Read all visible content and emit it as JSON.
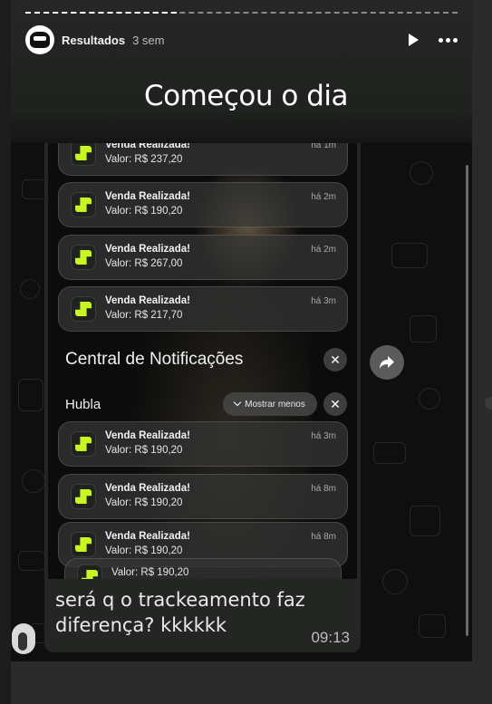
{
  "story": {
    "username": "Resultados",
    "time_ago": "3 sem",
    "progress": 0.35,
    "caption": "Começou o dia"
  },
  "icons": {
    "play": "play-icon",
    "more": "more-options-icon",
    "forward": "share-forward-icon",
    "close": "close-icon",
    "chevron": "chevron-down-icon",
    "app_logo": "hubla-logo-icon"
  },
  "colors": {
    "accent_green": "#c9f522",
    "background": "#141414",
    "bubble": "#232623"
  },
  "notifications_top": [
    {
      "title": "Venda Realizada!",
      "value": "Valor: R$ 237,20",
      "ago": "há 1m"
    },
    {
      "title": "Venda Realizada!",
      "value": "Valor: R$ 190,20",
      "ago": "há 2m"
    },
    {
      "title": "Venda Realizada!",
      "value": "Valor: R$ 267,00",
      "ago": "há 2m"
    },
    {
      "title": "Venda Realizada!",
      "value": "Valor: R$ 217,70",
      "ago": "há 3m"
    }
  ],
  "central": {
    "title": "Central de Notificações",
    "close": "✕"
  },
  "group": {
    "name": "Hubla",
    "toggle_label": "Mostrar menos",
    "close": "✕"
  },
  "notifications_bottom": [
    {
      "title": "Venda Realizada!",
      "value": "Valor: R$ 190,20",
      "ago": "há 3m"
    },
    {
      "title": "Venda Realizada!",
      "value": "Valor: R$ 190,20",
      "ago": "há 8m"
    },
    {
      "title": "Venda Realizada!",
      "value": "Valor: R$ 190,20",
      "ago": "há 8m"
    },
    {
      "title": "",
      "value": "Valor: R$ 190,20",
      "ago": ""
    }
  ],
  "message": {
    "text": "será q o trackeamento faz diferença? kkkkkk",
    "time": "09:13"
  }
}
